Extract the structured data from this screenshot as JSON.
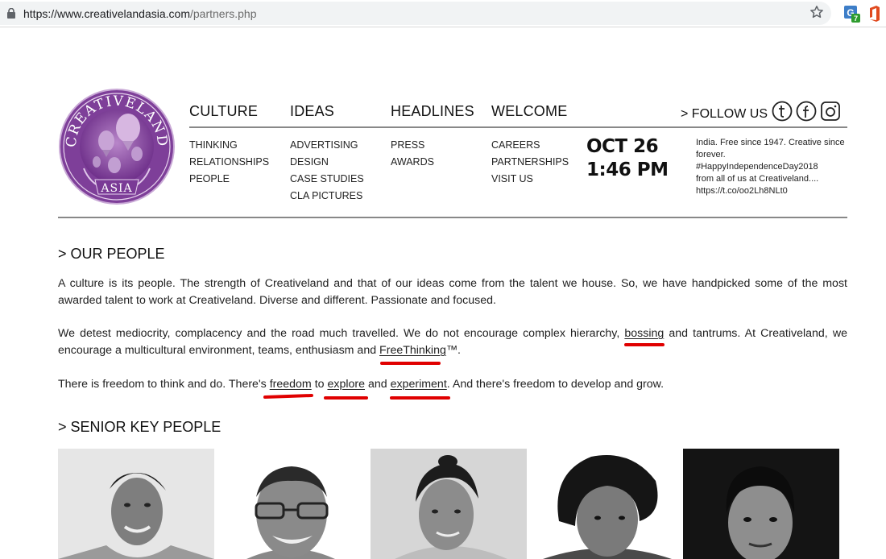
{
  "browser": {
    "url_domain": "https://www.creativelandasia.com",
    "url_path": "/partners.php",
    "extension_badge": "7"
  },
  "logo": {
    "text_top": "CREATIVELAND",
    "text_bottom": "ASIA"
  },
  "nav": [
    {
      "heading": "CULTURE",
      "items": [
        "THINKING",
        "RELATIONSHIPS",
        "PEOPLE"
      ]
    },
    {
      "heading": "IDEAS",
      "items": [
        "ADVERTISING",
        "DESIGN",
        "CASE STUDIES",
        "CLA PICTURES"
      ]
    },
    {
      "heading": "HEADLINES",
      "items": [
        "PRESS",
        "AWARDS"
      ]
    },
    {
      "heading": "WELCOME",
      "items": [
        "CAREERS",
        "PARTNERSHIPS",
        "VISIT US"
      ]
    }
  ],
  "follow_us": "> FOLLOW US",
  "social_icons": [
    "tumblr-icon",
    "facebook-icon",
    "instagram-icon"
  ],
  "datetime": {
    "date": "OCT 26",
    "time": "1:46 PM"
  },
  "tweet": [
    "India. Free since 1947. Creative since forever.",
    "#HappyIndependenceDay2018",
    "from all of us at Creativeland....",
    "https://t.co/oo2Lh8NLt0"
  ],
  "our_people": {
    "title": "> OUR PEOPLE",
    "p1": "A culture is its people. The strength of Creativeland and that of our ideas come from the talent we house. So, we have handpicked some of the most awarded talent to work at Creativeland. Diverse and different. Passionate and focused.",
    "p2_a": "We detest mediocrity, complacency and the road much travelled. We do not encourage complex hierarchy, ",
    "p2_bossing": "bossing",
    "p2_b": " and tantrums. At Creativeland, we encourage a multicultural environment, teams, enthusiasm and ",
    "p2_freethinking": "FreeThinking",
    "p2_c": "™.",
    "p3_a": "There is freedom to think and do. There's ",
    "p3_freedom": "freedom",
    "p3_to": " to ",
    "p3_explore": "explore",
    "p3_and": " and ",
    "p3_experiment": "experiment",
    "p3_b": ". And there's freedom to develop and grow."
  },
  "senior_key_people": {
    "title": "> SENIOR KEY PEOPLE"
  },
  "colors": {
    "logo_purple": "#8e4fa5",
    "annotation_red": "#e00000",
    "rule_gray": "#888888"
  }
}
